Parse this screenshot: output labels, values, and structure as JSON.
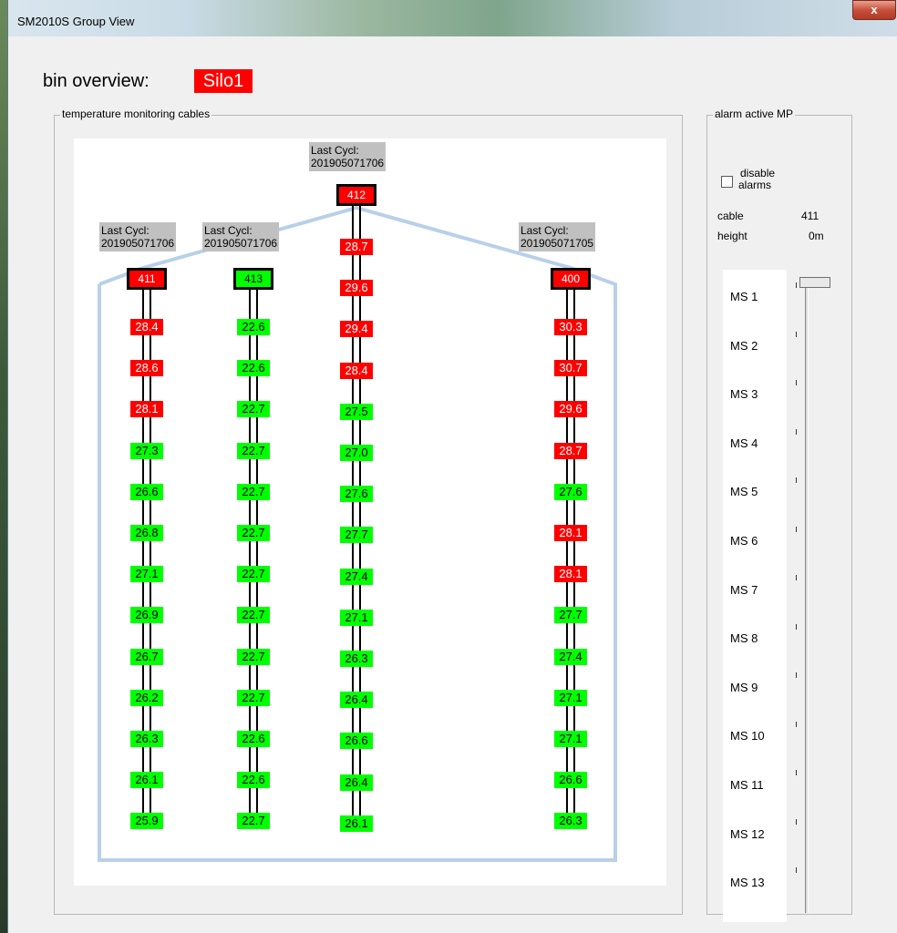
{
  "window": {
    "title": "SM2010S Group View",
    "close_label": "x"
  },
  "bin": {
    "label": "bin overview:",
    "value": "Silo1"
  },
  "groups": {
    "cables": "temperature monitoring cables",
    "alarm": "alarm active MP"
  },
  "alarm": {
    "disable_label_1": "disable",
    "disable_label_2": "alarms",
    "cable_label": "cable",
    "cable_value": "411",
    "height_label": "height",
    "height_value": "0m",
    "disable_checked": false
  },
  "cables": [
    {
      "id": "411",
      "head_color": "red",
      "last_cycle_label": "Last Cycl:",
      "last_cycle_value": "201905071706",
      "sensors": [
        {
          "v": "28.4",
          "c": "red"
        },
        {
          "v": "28.6",
          "c": "red"
        },
        {
          "v": "28.1",
          "c": "red"
        },
        {
          "v": "27.3",
          "c": "green"
        },
        {
          "v": "26.6",
          "c": "green"
        },
        {
          "v": "26.8",
          "c": "green"
        },
        {
          "v": "27.1",
          "c": "green"
        },
        {
          "v": "26.9",
          "c": "green"
        },
        {
          "v": "26.7",
          "c": "green"
        },
        {
          "v": "26.2",
          "c": "green"
        },
        {
          "v": "26.3",
          "c": "green"
        },
        {
          "v": "26.1",
          "c": "green"
        },
        {
          "v": "25.9",
          "c": "green"
        }
      ]
    },
    {
      "id": "413",
      "head_color": "green",
      "last_cycle_label": "Last Cycl:",
      "last_cycle_value": "201905071706",
      "sensors": [
        {
          "v": "22.6",
          "c": "green"
        },
        {
          "v": "22.6",
          "c": "green"
        },
        {
          "v": "22.7",
          "c": "green"
        },
        {
          "v": "22.7",
          "c": "green"
        },
        {
          "v": "22.7",
          "c": "green"
        },
        {
          "v": "22.7",
          "c": "green"
        },
        {
          "v": "22.7",
          "c": "green"
        },
        {
          "v": "22.7",
          "c": "green"
        },
        {
          "v": "22.7",
          "c": "green"
        },
        {
          "v": "22.7",
          "c": "green"
        },
        {
          "v": "22.6",
          "c": "green"
        },
        {
          "v": "22.6",
          "c": "green"
        },
        {
          "v": "22.7",
          "c": "green"
        }
      ]
    },
    {
      "id": "412",
      "head_color": "red",
      "last_cycle_label": "Last Cycl:",
      "last_cycle_value": "201905071706",
      "sensors": [
        {
          "v": "28.7",
          "c": "red"
        },
        {
          "v": "29.6",
          "c": "red"
        },
        {
          "v": "29.4",
          "c": "red"
        },
        {
          "v": "28.4",
          "c": "red"
        },
        {
          "v": "27.5",
          "c": "green"
        },
        {
          "v": "27.0",
          "c": "green"
        },
        {
          "v": "27.6",
          "c": "green"
        },
        {
          "v": "27.7",
          "c": "green"
        },
        {
          "v": "27.4",
          "c": "green"
        },
        {
          "v": "27.1",
          "c": "green"
        },
        {
          "v": "26.3",
          "c": "green"
        },
        {
          "v": "26.4",
          "c": "green"
        },
        {
          "v": "26.6",
          "c": "green"
        },
        {
          "v": "26.4",
          "c": "green"
        },
        {
          "v": "26.1",
          "c": "green"
        }
      ]
    },
    {
      "id": "400",
      "head_color": "red",
      "last_cycle_label": "Last Cycl:",
      "last_cycle_value": "201905071705",
      "sensors": [
        {
          "v": "30.3",
          "c": "red"
        },
        {
          "v": "30.7",
          "c": "red"
        },
        {
          "v": "29.6",
          "c": "red"
        },
        {
          "v": "28.7",
          "c": "red"
        },
        {
          "v": "27.6",
          "c": "green"
        },
        {
          "v": "28.1",
          "c": "red"
        },
        {
          "v": "28.1",
          "c": "red"
        },
        {
          "v": "27.7",
          "c": "green"
        },
        {
          "v": "27.4",
          "c": "green"
        },
        {
          "v": "27.1",
          "c": "green"
        },
        {
          "v": "27.1",
          "c": "green"
        },
        {
          "v": "26.6",
          "c": "green"
        },
        {
          "v": "26.3",
          "c": "green"
        }
      ]
    }
  ],
  "ms_list": [
    "MS 1",
    "MS 2",
    "MS 3",
    "MS 4",
    "MS 5",
    "MS 6",
    "MS 7",
    "MS 8",
    "MS 9",
    "MS 10",
    "MS 11",
    "MS 12",
    "MS 13"
  ],
  "colors": {
    "alarm": "#ff0000",
    "ok": "#00ff00",
    "silo_outline": "#b8d0e8"
  }
}
